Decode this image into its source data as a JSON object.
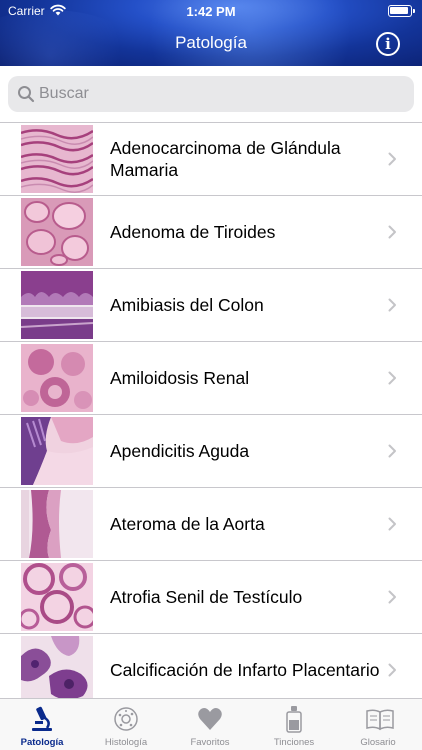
{
  "status": {
    "carrier": "Carrier",
    "time": "1:42 PM"
  },
  "nav": {
    "title": "Patología"
  },
  "search": {
    "placeholder": "Buscar"
  },
  "items": [
    {
      "label": "Adenocarcinoma de Glándula Mamaria"
    },
    {
      "label": "Adenoma de Tiroides"
    },
    {
      "label": "Amibiasis del Colon"
    },
    {
      "label": "Amiloidosis Renal"
    },
    {
      "label": "Apendicitis Aguda"
    },
    {
      "label": "Ateroma de la Aorta"
    },
    {
      "label": "Atrofia Senil de Testículo"
    },
    {
      "label": "Calcificación de Infarto Placentario"
    }
  ],
  "tabs": [
    {
      "label": "Patología",
      "icon": "microscope-icon",
      "active": true
    },
    {
      "label": "Histología",
      "icon": "cell-icon",
      "active": false
    },
    {
      "label": "Favoritos",
      "icon": "heart-icon",
      "active": false
    },
    {
      "label": "Tinciones",
      "icon": "stain-bottle-icon",
      "active": false
    },
    {
      "label": "Glosario",
      "icon": "book-icon",
      "active": false
    }
  ],
  "colors": {
    "accent": "#0a2a8c",
    "inactive": "#8e8e93",
    "separator": "#c8c7cc"
  }
}
